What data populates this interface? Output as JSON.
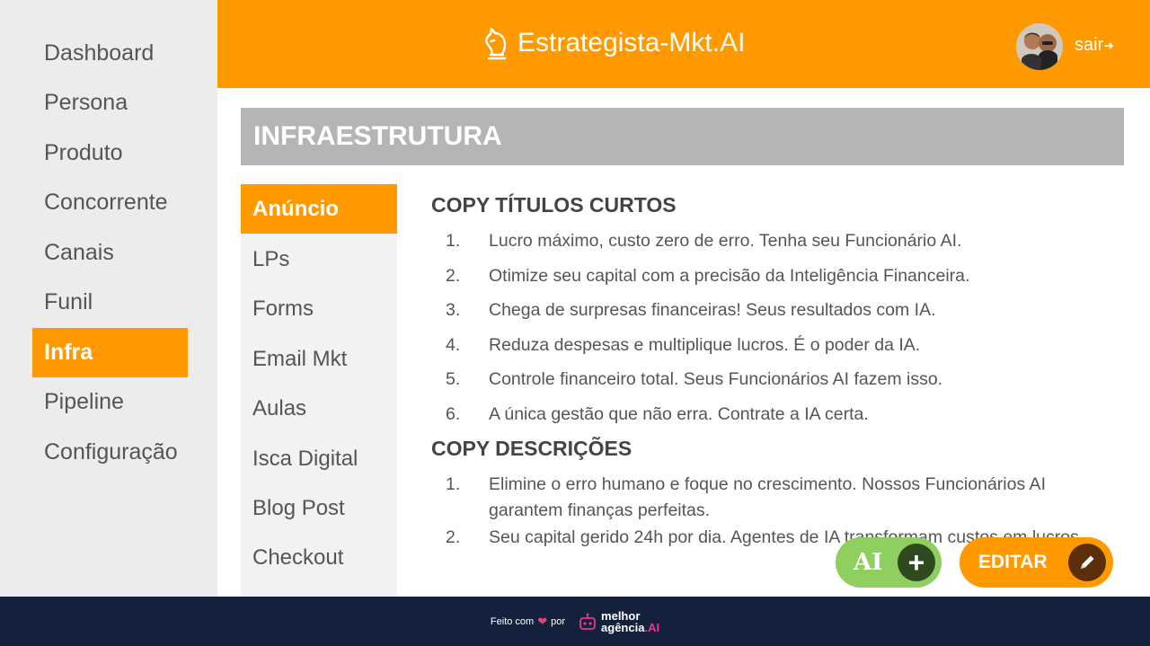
{
  "sidebar": {
    "items": [
      {
        "label": "Dashboard"
      },
      {
        "label": "Persona"
      },
      {
        "label": "Produto"
      },
      {
        "label": "Concorrente"
      },
      {
        "label": "Canais"
      },
      {
        "label": "Funil"
      },
      {
        "label": "Infra",
        "active": true
      },
      {
        "label": "Pipeline"
      },
      {
        "label": "Configuração"
      }
    ]
  },
  "header": {
    "brand": "Estrategista-Mkt.",
    "brand_suffix": "AI",
    "logo_icon": "chess-knight-icon",
    "logout_label": "sair",
    "logout_icon": "arrow-right-icon"
  },
  "section": {
    "title": "INFRAESTRUTURA"
  },
  "subnav": {
    "items": [
      {
        "label": "Anúncio",
        "active": true
      },
      {
        "label": "LPs"
      },
      {
        "label": "Forms"
      },
      {
        "label": "Email Mkt"
      },
      {
        "label": "Aulas"
      },
      {
        "label": "Isca Digital"
      },
      {
        "label": "Blog Post"
      },
      {
        "label": "Checkout"
      }
    ]
  },
  "content": {
    "titles_heading": "COPY TÍTULOS CURTOS",
    "titles": [
      {
        "num": "1.",
        "text": "Lucro máximo, custo zero de erro. Tenha seu Funcionário AI."
      },
      {
        "num": "2.",
        "text": "Otimize seu capital com a precisão da Inteligência Financeira."
      },
      {
        "num": "3.",
        "text": "Chega de surpresas financeiras! Seus resultados com IA."
      },
      {
        "num": "4.",
        "text": "Reduza despesas e multiplique lucros. É o poder da IA."
      },
      {
        "num": "5.",
        "text": "Controle financeiro total. Seus Funcionários AI fazem isso."
      },
      {
        "num": "6.",
        "text": "A única gestão que não erra. Contrate a IA certa."
      }
    ],
    "descriptions_heading": "COPY DESCRIÇÕES",
    "descriptions": [
      {
        "num": "1.",
        "text": "Elimine o erro humano e foque no crescimento. Nossos Funcionários AI garantem finanças perfeitas."
      },
      {
        "num": "2.",
        "text": "Seu capital gerido 24h por dia. Agentes de IA transformam custos em lucros."
      }
    ]
  },
  "actions": {
    "ai_label": "AI",
    "ai_plus": "+",
    "edit_label": "EDITAR",
    "edit_icon": "pencil-icon"
  },
  "footer": {
    "made_with": "Feito com",
    "by": "por",
    "agency_line1": "melhor",
    "agency_line2": "agência",
    "agency_suffix": ".AI"
  },
  "colors": {
    "accent": "#ff9900",
    "sidebar_bg": "#ececec",
    "section_bg": "#b5b5b5",
    "footer_bg": "#14213d",
    "ai_green": "#8fcf5f"
  }
}
